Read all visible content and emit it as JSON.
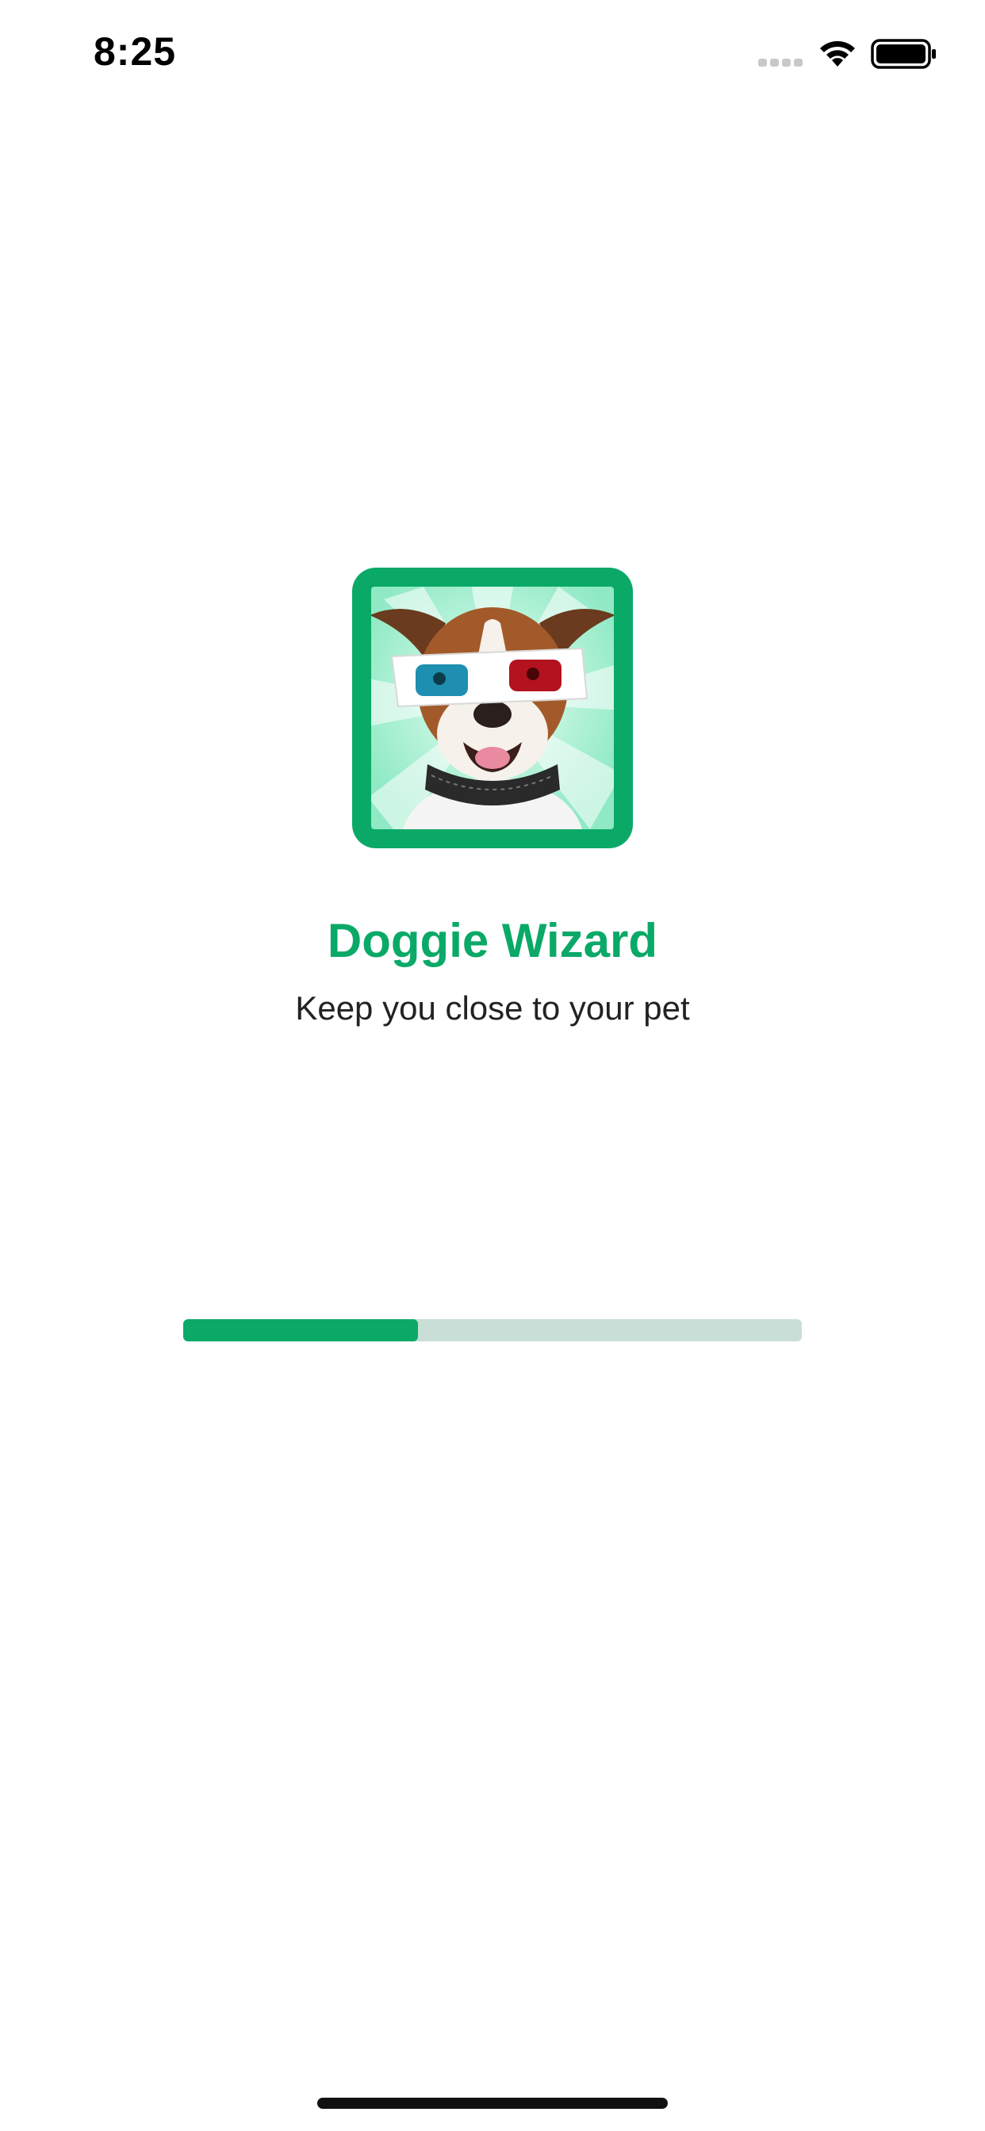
{
  "status_bar": {
    "time": "8:25",
    "icons": [
      "cellular-signal-icon",
      "wifi-icon",
      "battery-icon"
    ]
  },
  "app": {
    "icon": "dog-with-3d-glasses-app-icon",
    "title": "Doggie Wizard",
    "tagline": "Keep you close to your pet"
  },
  "loading": {
    "progress": 0.38
  },
  "colors": {
    "accent": "#0aa968",
    "track": "#c9ded6",
    "text": "#222222"
  }
}
